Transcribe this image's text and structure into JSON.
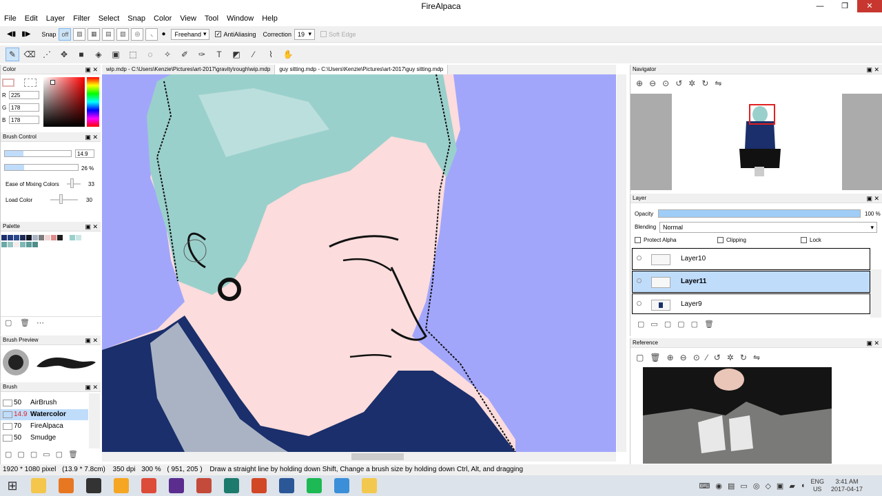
{
  "window": {
    "title": "FireAlpaca",
    "min": "—",
    "max": "❐",
    "close": "✕"
  },
  "menu": [
    "File",
    "Edit",
    "Layer",
    "Filter",
    "Select",
    "Snap",
    "Color",
    "View",
    "Tool",
    "Window",
    "Help"
  ],
  "tool_options": {
    "snap_label": "Snap",
    "snap_off": "off",
    "brush_mode": "Freehand",
    "antialiasing_label": "AntiAliasing",
    "correction_label": "Correction",
    "correction_value": "19",
    "soft_edge_label": "Soft Edge"
  },
  "tabs": [
    {
      "label": "wip.mdp - C:\\Users\\Kenzie\\Pictures\\art-2017\\gravity\\rough\\wip.mdp"
    },
    {
      "label": "guy sitting.mdp - C:\\Users\\Kenzie\\Pictures\\art-2017\\guy sitting.mdp"
    }
  ],
  "color_panel": {
    "title": "Color",
    "r_label": "R",
    "g_label": "G",
    "b_label": "B",
    "r": "225",
    "g": "178",
    "b": "178",
    "current_color": "#e1b2b2"
  },
  "brush_control": {
    "title": "Brush Control",
    "size": "14.9",
    "opacity": "26 %",
    "size_level": 0.28,
    "opacity_level": 0.26,
    "mixing_label": "Ease of Mixing Colors",
    "mixing": "33",
    "load_label": "Load Color",
    "load": "30"
  },
  "palette": {
    "title": "Palette",
    "swatches": [
      "#1a2f6b",
      "#243b80",
      "#2b4a8c",
      "#1e2a55",
      "#101624",
      "#aab3c4",
      "#7c7c7c",
      "#f2d4d4",
      "#e08b8b",
      "#1c1c1c",
      "#ffffff",
      "#9ad0cc",
      "#c9e6e3",
      "#6aa9a6",
      "#9cc5c2",
      "#f3ecec",
      "#7fb8b4",
      "#5c9d99",
      "#4e8d8a"
    ]
  },
  "brush_preview": {
    "title": "Brush Preview"
  },
  "brush_panel": {
    "title": "Brush",
    "items": [
      {
        "size": "50",
        "name": "AirBrush",
        "sel": false
      },
      {
        "size": "14.9",
        "name": "Watercolor",
        "sel": true
      },
      {
        "size": "70",
        "name": "FireAlpaca",
        "sel": false
      },
      {
        "size": "50",
        "name": "Smudge",
        "sel": false
      }
    ]
  },
  "navigator": {
    "title": "Navigator"
  },
  "layer_panel": {
    "title": "Layer",
    "opacity_label": "Opacity",
    "opacity_value": "100 %",
    "opacity_level": 1,
    "blending_label": "Blending",
    "blending_value": "Normal",
    "protect_alpha": "Protect Alpha",
    "clipping": "Clipping",
    "lock": "Lock",
    "layers": [
      {
        "name": "Layer10",
        "sel": false
      },
      {
        "name": "Layer11",
        "sel": true
      },
      {
        "name": "Layer9",
        "sel": false
      }
    ]
  },
  "reference": {
    "title": "Reference"
  },
  "status": {
    "size": "1920 * 1080 pixel",
    "cm": "(13.9 * 7.8cm)",
    "dpi": "350 dpi",
    "zoom": "300 %",
    "coords": "( 951, 205 )",
    "hint": "Draw a straight line by holding down Shift, Change a brush size by holding down Ctrl, Alt, and dragging"
  },
  "taskbar": {
    "lang": "ENG",
    "region": "US",
    "time": "3:41 AM",
    "date": "2017-04-17",
    "apps": [
      "#f4c64c",
      "#e87722",
      "#333333",
      "#f5a623",
      "#dd4b39",
      "#5b2d8e",
      "#c44a3a",
      "#1d7b6e",
      "#d24726",
      "#2b5797",
      "#1db954",
      "#3b8fd9",
      "#f3c84e"
    ]
  }
}
